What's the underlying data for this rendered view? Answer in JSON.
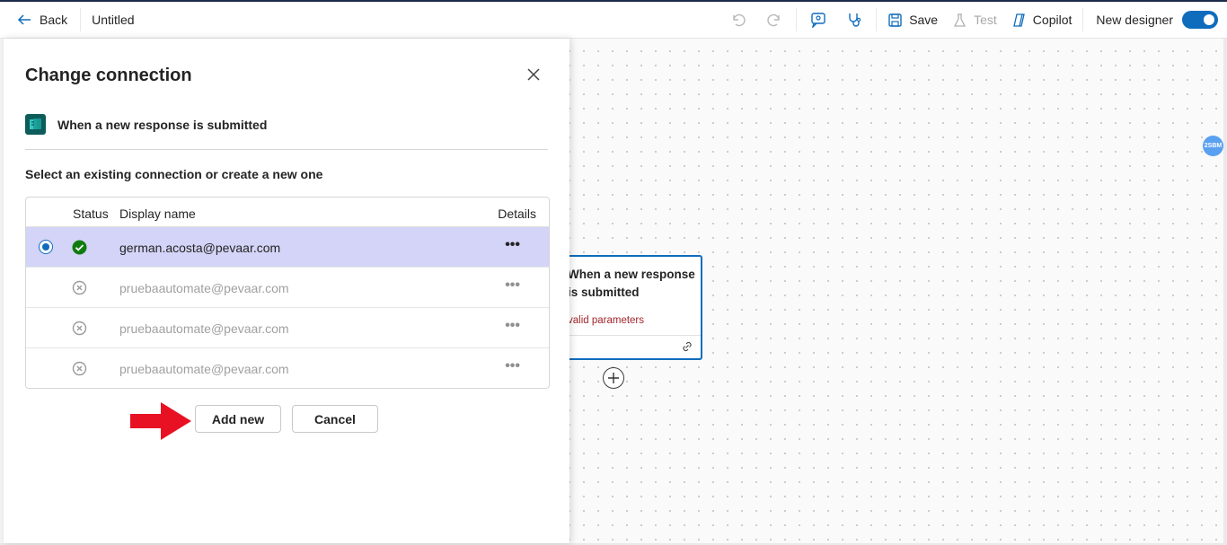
{
  "topbar": {
    "back_label": "Back",
    "flow_title": "Untitled",
    "save_label": "Save",
    "test_label": "Test",
    "copilot_label": "Copilot",
    "new_designer_label": "New designer",
    "new_designer_on": true
  },
  "panel": {
    "title": "Change connection",
    "trigger_label": "When a new response is submitted",
    "instruction": "Select an existing connection or create a new one",
    "table": {
      "headers": {
        "status": "Status",
        "display_name": "Display name",
        "details": "Details"
      },
      "rows": [
        {
          "display_name": "german.acosta@pevaar.com",
          "status": "ok",
          "selected": true,
          "details": "•••"
        },
        {
          "display_name": "pruebaautomate@pevaar.com",
          "status": "error",
          "selected": false,
          "details": "•••"
        },
        {
          "display_name": "pruebaautomate@pevaar.com",
          "status": "error",
          "selected": false,
          "details": "•••"
        },
        {
          "display_name": "pruebaautomate@pevaar.com",
          "status": "error",
          "selected": false,
          "details": "•••"
        }
      ]
    },
    "add_new_label": "Add new",
    "cancel_label": "Cancel"
  },
  "canvas": {
    "card_title": "When a new response is submitted",
    "card_error": "valid parameters",
    "avatar_initials": "2SBM"
  },
  "colors": {
    "accent": "#0f6cbd",
    "selected_row": "#d3d4f7",
    "success": "#107c10",
    "error_text": "#a4262c",
    "annotation_arrow": "#e81123"
  }
}
